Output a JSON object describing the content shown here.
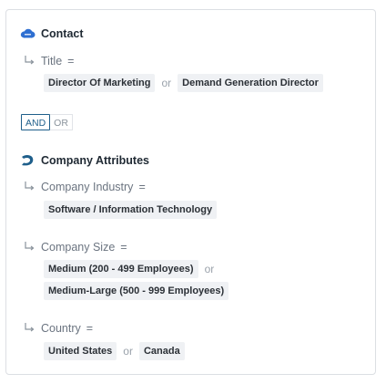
{
  "contact": {
    "section_title": "Contact",
    "title_field": {
      "label": "Title",
      "operator": "=",
      "values": [
        "Director Of Marketing",
        "Demand Generation Director"
      ],
      "joiner": "or"
    }
  },
  "logic_toggle": {
    "and_label": "AND",
    "or_label": "OR",
    "selected": "AND"
  },
  "company": {
    "section_title": "Company Attributes",
    "industry": {
      "label": "Company Industry",
      "operator": "=",
      "values": [
        "Software / Information Technology"
      ]
    },
    "size": {
      "label": "Company Size",
      "operator": "=",
      "values": [
        "Medium (200 - 499 Employees)",
        "Medium-Large (500 - 999 Employees)"
      ],
      "joiner": "or"
    },
    "country": {
      "label": "Country",
      "operator": "=",
      "values": [
        "United States",
        "Canada"
      ],
      "joiner": "or"
    }
  },
  "colors": {
    "accent": "#1f5f8b",
    "icon_blue": "#2e6fd1",
    "tag_bg": "#eff1f4"
  },
  "icons": {
    "contact": "salesforce-cloud-icon",
    "company": "company-logo-icon",
    "branch": "branch-arrow-icon"
  }
}
